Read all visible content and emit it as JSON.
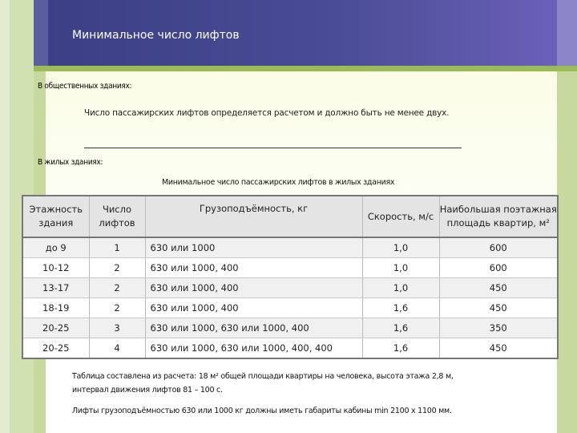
{
  "slide": {
    "title": "Минимальное число лифтов",
    "public_label": "В общественных зданиях:",
    "public_rule": "Число пассажирских лифтов определяется расчетом и должно быть не менее двух.",
    "residential_label": "В жилых зданиях:",
    "table_caption": "Минимальное число пассажирских лифтов в жилых зданиях"
  },
  "table": {
    "headers": [
      "Этажность здания",
      "Число лифтов",
      "Грузоподъёмность, кг",
      "Скорость, м/с",
      "Наибольшая поэтажная площадь квартир, м²"
    ],
    "rows": [
      [
        "до 9",
        "1",
        "630 или 1000",
        "1,0",
        "600"
      ],
      [
        "10-12",
        "2",
        "630 или 1000, 400",
        "1,0",
        "600"
      ],
      [
        "13-17",
        "2",
        "630 или 1000, 400",
        "1,0",
        "450"
      ],
      [
        "18-19",
        "2",
        "630 или 1000, 400",
        "1,6",
        "450"
      ],
      [
        "20-25",
        "3",
        "630 или 1000, 630 или 1000, 400",
        "1,6",
        "350"
      ],
      [
        "20-25",
        "4",
        "630 или 1000, 630 или 1000, 400, 400",
        "1,6",
        "450"
      ]
    ]
  },
  "notes": {
    "calc_line1": "Таблица составлена из расчета: 18 м² общей площади квартиры на человека, высота этажа 2,8 м,",
    "calc_line2": "интервал движения лифтов 81 – 100 с.",
    "cabin": "Лифты грузоподъёмностью 630 или 1000 кг должны иметь габариты кабины min 2100 х 1100 мм."
  },
  "colors": {
    "header": "#494c94",
    "accent": "#9bbb59",
    "side_bands": "#c7d99e"
  }
}
